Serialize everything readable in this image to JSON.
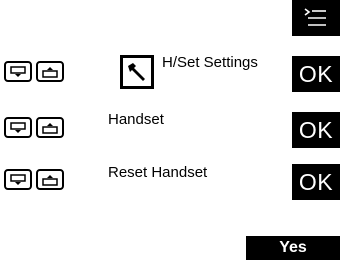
{
  "rows": [
    {
      "label": "H/Set Settings",
      "ok": "OK",
      "has_icon": true
    },
    {
      "label": "Handset",
      "ok": "OK"
    },
    {
      "label": "Reset Handset",
      "ok": "OK"
    }
  ],
  "softkey": {
    "label": "Yes"
  },
  "icons": {
    "menu": "menu-icon",
    "down": "down-arrow-key-icon",
    "up": "up-arrow-key-icon",
    "settings": "wrench-icon"
  }
}
